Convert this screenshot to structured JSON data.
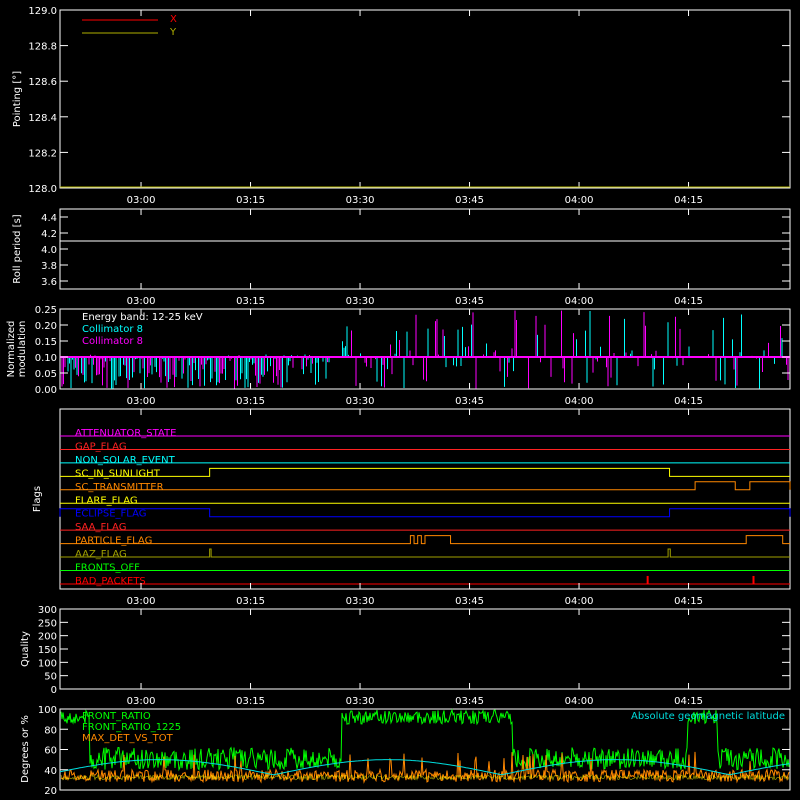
{
  "time_ticks": [
    "03:00",
    "03:15",
    "03:30",
    "03:45",
    "04:00",
    "04:15"
  ],
  "colors": {
    "background": "#000000",
    "axes": "#ffffff",
    "x": "#ff0000",
    "y": "#b0b000",
    "roll": "#ffffff",
    "collimator_8_cyan": "#00ffff",
    "collimator_8_magenta": "#ff00ff",
    "front_ratio": "#00ff00",
    "max_det": "#ff8800",
    "geomag": "#00dddd",
    "yellow_overlay": "#ffff00"
  },
  "chart_data": [
    {
      "type": "line",
      "ylabel": "Pointing [°]",
      "ylim": [
        128.0,
        129.0
      ],
      "yticks": [
        "128.0",
        "128.2",
        "128.4",
        "128.6",
        "128.8",
        "129.0"
      ],
      "series": [
        {
          "name": "X",
          "color": "#ff0000",
          "values": [
            128.0,
            128.0
          ]
        },
        {
          "name": "Y",
          "color": "#b0b000",
          "values": [
            128.0,
            128.0
          ]
        }
      ],
      "legend": "top-left"
    },
    {
      "type": "line",
      "ylabel": "Roll period [s]",
      "ylim": [
        3.5,
        4.5
      ],
      "yticks": [
        "3.6",
        "3.8",
        "4.0",
        "4.2",
        "4.4"
      ],
      "series": [
        {
          "color": "#ffffff",
          "value": 4.1
        }
      ]
    },
    {
      "type": "bar",
      "ylabel": [
        "Normalized",
        "modulation"
      ],
      "ylim": [
        0.0,
        0.25
      ],
      "yticks": [
        "0.00",
        "0.05",
        "0.10",
        "0.15",
        "0.20",
        "0.25"
      ],
      "annotation": "Energy band: 12-25 keV",
      "series": [
        {
          "name": "Collimator 8",
          "color": "#00ffff",
          "baseline": 0.1
        },
        {
          "name": "Collimator 8",
          "color": "#ff00ff",
          "baseline": 0.1
        }
      ],
      "legend": "top-left"
    },
    {
      "type": "line",
      "ylabel": "Flags",
      "flags": [
        {
          "name": "ATTENUATOR_STATE",
          "color": "#ff00ff",
          "segments": []
        },
        {
          "name": "GAP_FLAG",
          "color": "#ff2222",
          "segments": []
        },
        {
          "name": "NON_SOLAR_EVENT",
          "color": "#00ffff",
          "segments": []
        },
        {
          "name": "SC_IN_SUNLIGHT",
          "color": "#ffff00",
          "segments": [
            [
              0.205,
              0.835
            ]
          ]
        },
        {
          "name": "SC_TRANSMITTER",
          "color": "#ff8800",
          "segments": [
            [
              0.87,
              0.925
            ],
            [
              0.945,
              1.0
            ]
          ]
        },
        {
          "name": "FLARE_FLAG",
          "color": "#ffff00",
          "segments": []
        },
        {
          "name": "ECLIPSE_FLAG",
          "color": "#0000ff",
          "segments": [
            [
              0.0,
              0.205
            ],
            [
              0.835,
              1.0
            ]
          ]
        },
        {
          "name": "SAA_FLAG",
          "color": "#ff2222",
          "segments": []
        },
        {
          "name": "PARTICLE_FLAG",
          "color": "#ff8800",
          "segments": [
            [
              0.48,
              0.485
            ],
            [
              0.49,
              0.495
            ],
            [
              0.5,
              0.535
            ],
            [
              0.94,
              0.99
            ]
          ]
        },
        {
          "name": "AAZ_FLAG",
          "color": "#a0a000",
          "segments": [
            [
              0.205,
              0.207
            ],
            [
              0.833,
              0.836
            ]
          ]
        },
        {
          "name": "FRONTS_OFF",
          "color": "#00ff00",
          "segments": []
        },
        {
          "name": "BAD_PACKETS",
          "color": "#ff0000",
          "spikes": [
            0.805,
            0.95
          ]
        }
      ]
    },
    {
      "type": "line",
      "ylabel": "Quality",
      "ylim": [
        0,
        300
      ],
      "yticks": [
        "0",
        "50",
        "100",
        "150",
        "200",
        "250",
        "300"
      ],
      "series": [
        {
          "values": []
        }
      ]
    },
    {
      "type": "line",
      "ylabel": "Degrees or %",
      "ylim": [
        20,
        100
      ],
      "yticks": [
        "20",
        "40",
        "60",
        "80",
        "100"
      ],
      "series": [
        {
          "name": "FRONT_RATIO",
          "color": "#00ff00"
        },
        {
          "name": "FRONT_RATIO_1225",
          "color": "#00ff00"
        },
        {
          "name": "MAX_DET_VS_TOT",
          "color": "#ff8800"
        },
        {
          "name": "Absolute geomagnetic latitude",
          "color": "#00dddd"
        }
      ]
    }
  ]
}
